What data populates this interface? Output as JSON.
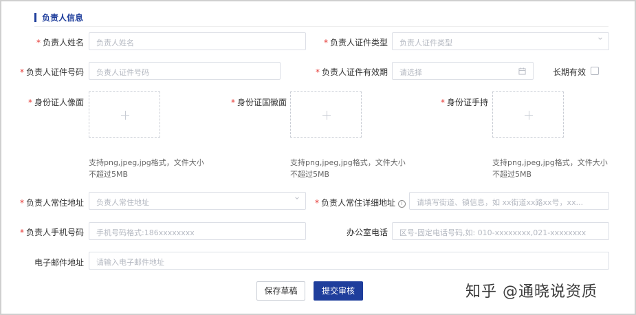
{
  "section": {
    "title": "负责人信息"
  },
  "fields": {
    "name": {
      "label": "负责人姓名",
      "placeholder": "负责人姓名"
    },
    "id_type": {
      "label": "负责人证件类型",
      "placeholder": "负责人证件类型"
    },
    "id_number": {
      "label": "负责人证件号码",
      "placeholder": "负责人证件号码"
    },
    "id_validity": {
      "label": "负责人证件有效期",
      "placeholder": "请选择"
    },
    "long_term": {
      "label": "长期有效"
    },
    "address": {
      "label": "负责人常住地址",
      "placeholder": "负责人常住地址"
    },
    "address_detail": {
      "label": "负责人常住详细地址",
      "placeholder": "请填写街道、镇信息，如 xx街道xx路xx号，xx..."
    },
    "phone": {
      "label": "负责人手机号码",
      "placeholder": "手机号码格式:186xxxxxxxx"
    },
    "office_phone": {
      "label": "办公室电话",
      "placeholder": "区号-固定电话号码,如: 010-xxxxxxxx,021-xxxxxxxx"
    },
    "email": {
      "label": "电子邮件地址",
      "placeholder": "请输入电子邮件地址"
    }
  },
  "uploads": {
    "portrait": {
      "label": "身份证人像面",
      "hint": "支持png,jpeg,jpg格式，文件大小不超过5MB"
    },
    "emblem": {
      "label": "身份证国徽面",
      "hint": "支持png,jpeg,jpg格式，文件大小不超过5MB"
    },
    "handheld": {
      "label": "身份证手持",
      "hint": "支持png,jpeg,jpg格式，文件大小不超过5MB"
    }
  },
  "required_mark": "*",
  "info_icon_glyph": "i",
  "buttons": {
    "draft": "保存草稿",
    "submit": "提交审核"
  },
  "watermark": "知乎 @通晓说资质",
  "colors": {
    "accent": "#1f3e9c",
    "required": "#e53935",
    "border": "#dcdfe6",
    "placeholder": "#b5b9c2"
  }
}
